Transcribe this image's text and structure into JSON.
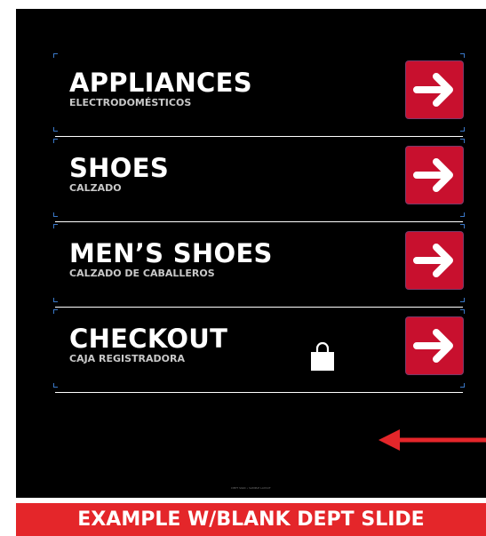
{
  "signs": [
    {
      "title": "APPLIANCES",
      "subtitle": "ELECTRODOMÉSTICOS",
      "icon": "arrow-right-icon"
    },
    {
      "title": "SHOES",
      "subtitle": "CALZADO",
      "icon": "arrow-right-icon"
    },
    {
      "title": "MEN’S SHOES",
      "subtitle": "CALZADO DE CABALLEROS",
      "icon": "arrow-right-icon"
    },
    {
      "title": "CHECKOUT",
      "subtitle": "CAJA REGISTRADORA",
      "icon": "arrow-right-icon",
      "extra_icon": "shopping-bag-icon"
    }
  ],
  "fineprint": "DEPT SIGN • SAMPLE LAYOUT",
  "banner": {
    "label": "EXAMPLE W/BLANK DEPT SLIDE"
  },
  "colors": {
    "panel_background": "#000000",
    "arrow_tile": "#c8102e",
    "banner_background": "#e4262a",
    "pointer_arrow": "#e4262a",
    "crop_marks": "#3a78c8"
  }
}
